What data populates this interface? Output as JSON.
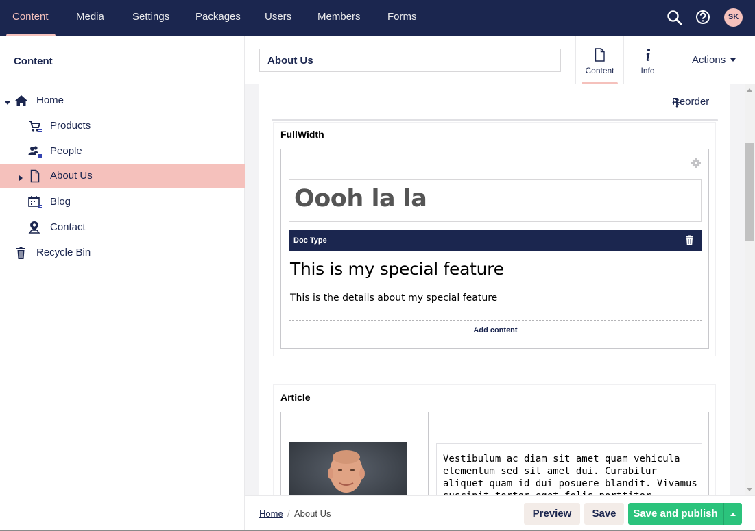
{
  "nav": {
    "items": [
      {
        "label": "Content",
        "active": true
      },
      {
        "label": "Media"
      },
      {
        "label": "Settings"
      },
      {
        "label": "Packages"
      },
      {
        "label": "Users"
      },
      {
        "label": "Members"
      },
      {
        "label": "Forms"
      }
    ],
    "tools": [
      "search-icon",
      "help-icon"
    ],
    "avatar_initials": "SK"
  },
  "sidebar": {
    "title": "Content",
    "tree": [
      {
        "label": "Home",
        "icon": "home-icon",
        "expanded": true
      },
      {
        "label": "Products",
        "icon": "shopping-cart-icon"
      },
      {
        "label": "People",
        "icon": "people-icon"
      },
      {
        "label": "About Us",
        "icon": "document-icon",
        "selected": true,
        "collapsed": true
      },
      {
        "label": "Blog",
        "icon": "calendar-icon"
      },
      {
        "label": "Contact",
        "icon": "map-pin-icon"
      },
      {
        "label": "Recycle Bin",
        "icon": "trash-icon"
      }
    ]
  },
  "header": {
    "name_value": "About Us",
    "apps": [
      {
        "label": "Content",
        "icon": "document-icon",
        "active": true
      },
      {
        "label": "Info",
        "icon": "info-icon"
      }
    ],
    "actions_label": "Actions"
  },
  "editor": {
    "reorder_label": "Reorder",
    "fullwidth": {
      "title": "FullWidth",
      "headline": "Oooh la la",
      "doctype": {
        "label": "Doc Type",
        "feature_title": "This is my special feature",
        "feature_desc": "This is the details about my special feature"
      },
      "add_content_label": "Add content"
    },
    "article": {
      "title": "Article",
      "text": "Vestibulum ac diam sit amet quam vehicula elementum sed sit amet dui. Curabitur aliquet quam id dui posuere blandit. Vivamus suscipit tortor eget felis porttitor volutpat. Proin eget tortor risus. Sed"
    }
  },
  "footer": {
    "breadcrumb": [
      "Home",
      "About Us"
    ],
    "breadcrumb_sep": "/",
    "preview_label": "Preview",
    "save_label": "Save",
    "publish_label": "Save and publish"
  },
  "colors": {
    "brand": "#1b264f",
    "accent": "#f5c1bc",
    "publish": "#2bc37c",
    "secondary_btn": "#f3ece8"
  }
}
